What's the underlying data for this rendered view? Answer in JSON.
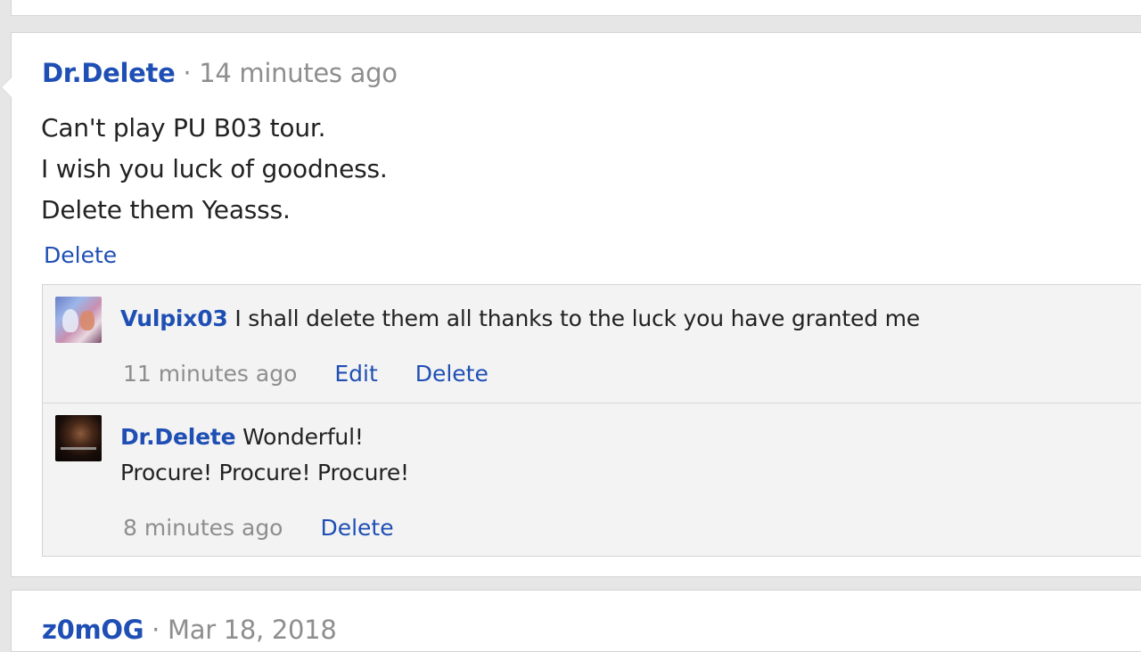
{
  "post": {
    "author": "Dr.Delete",
    "separator": "·",
    "time": "14 minutes ago",
    "lines": [
      "Can't play PU B03 tour.",
      "I wish you luck of goodness.",
      "Delete them Yeasss."
    ],
    "delete_label": "Delete"
  },
  "replies": [
    {
      "author": "Vulpix03",
      "text": "I shall delete them all thanks to the luck you have granted me",
      "time": "11 minutes ago",
      "edit_label": "Edit",
      "delete_label": "Delete"
    },
    {
      "author": "Dr.Delete",
      "text": "Wonderful!",
      "text_line2": "Procure! Procure! Procure!",
      "time": "8 minutes ago",
      "delete_label": "Delete"
    }
  ],
  "next_post": {
    "author": "z0mOG",
    "separator": "·",
    "time": "Mar 18, 2018"
  },
  "colors": {
    "link": "#1f4fb4",
    "muted": "#8e8e8e",
    "reply_bg": "#f3f3f3",
    "page_bg": "#e6e6e6"
  }
}
